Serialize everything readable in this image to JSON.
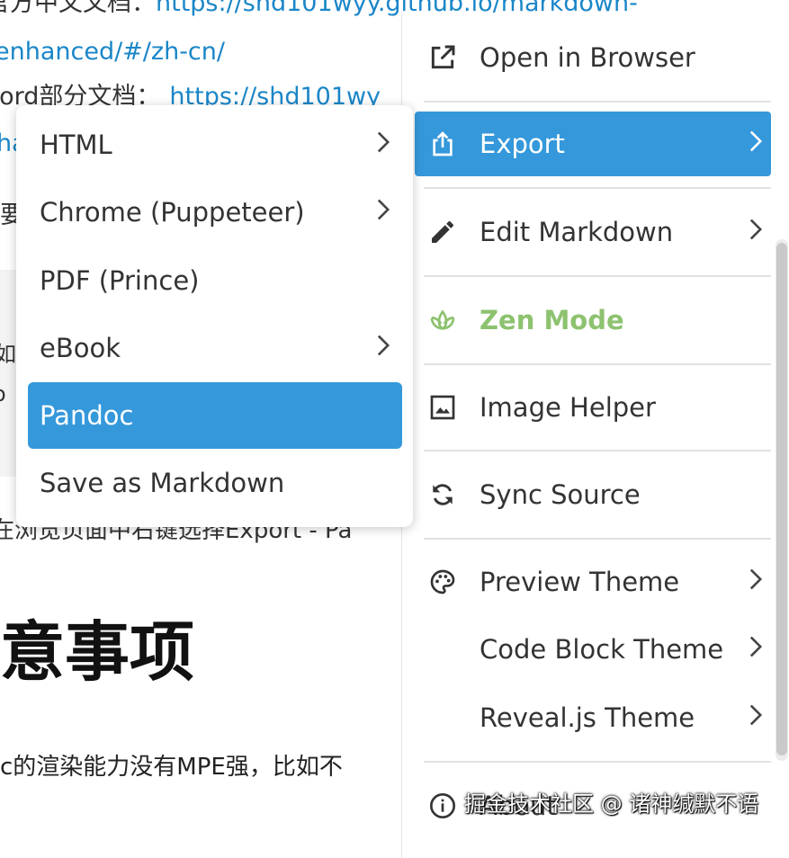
{
  "document": {
    "line1_text": "官方中文文档：",
    "line1_link": "https://shd101wyy.github.io/markdown-",
    "line2_link": "enhanced/#/zh-cn/",
    "line3_text": "Word部分文档：",
    "line3_link": "https://shd101wy",
    "line4_link": "ha",
    "line5_text": "要",
    "code_line1": "如",
    "code_line2": "o",
    "line6_text": "在浏览页面中右键选择Export - Pa",
    "heading": "意事项",
    "para": "c的渲染能力没有MPE强，比如不"
  },
  "menu": {
    "open_browser": "Open in Browser",
    "export": "Export",
    "edit_markdown": "Edit Markdown",
    "zen_mode": "Zen Mode",
    "image_helper": "Image Helper",
    "sync_source": "Sync Source",
    "preview_theme": "Preview Theme",
    "code_block_theme": "Code Block Theme",
    "revealjs_theme": "Reveal.js Theme",
    "about": "About"
  },
  "submenu": {
    "html": "HTML",
    "chrome": "Chrome (Puppeteer)",
    "pdf": "PDF (Prince)",
    "ebook": "eBook",
    "pandoc": "Pandoc",
    "save_markdown": "Save as Markdown"
  },
  "colors": {
    "accent": "#3598db",
    "zen": "#8dc26f",
    "link": "#1a86c8"
  },
  "watermark": "掘金技术社区 @ 诸神缄默不语"
}
